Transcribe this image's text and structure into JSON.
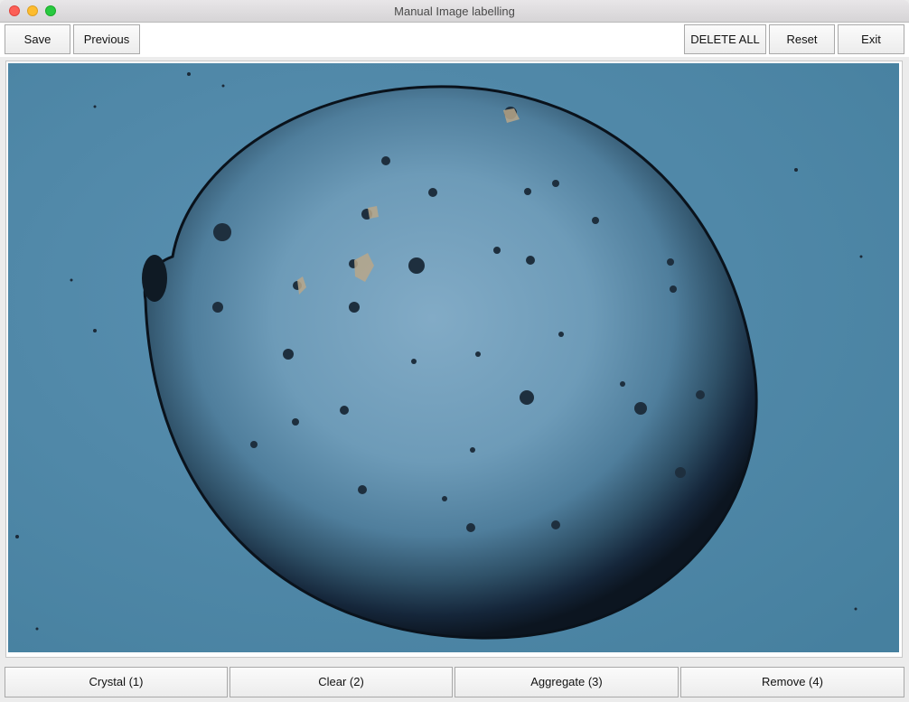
{
  "window": {
    "title": "Manual Image labelling"
  },
  "toolbar": {
    "save_label": "Save",
    "previous_label": "Previous",
    "delete_all_label": "DELETE ALL",
    "reset_label": "Reset",
    "exit_label": "Exit"
  },
  "labels": {
    "crystal_label": "Crystal (1)",
    "clear_label": "Clear (2)",
    "aggregate_label": "Aggregate (3)",
    "remove_label": "Remove (4)"
  },
  "image": {
    "subject": "microscope image of a droplet containing crystals",
    "background_color": "#4f87a7",
    "droplet_rim_color": "#0f1a24",
    "droplet_center_color": "#7fa9c4"
  },
  "colors": {
    "close": "#fc5f57",
    "minimize": "#fdbc2e",
    "maximize": "#28c940"
  }
}
